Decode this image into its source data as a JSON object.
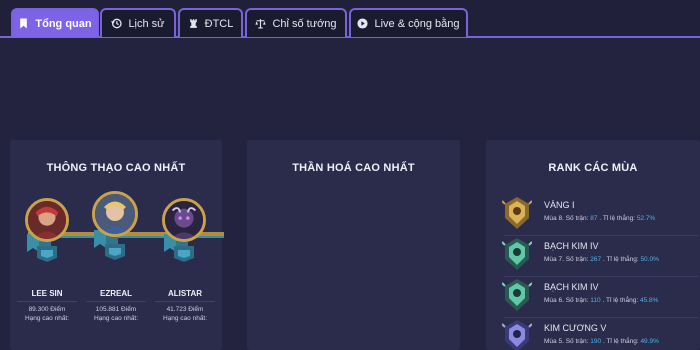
{
  "tabs": [
    {
      "label": "Tổng quan",
      "icon": "bookmark-icon",
      "active": true
    },
    {
      "label": "Lịch sử",
      "icon": "history-icon",
      "active": false
    },
    {
      "label": "ĐTCL",
      "icon": "chess-rook-icon",
      "active": false
    },
    {
      "label": "Chỉ số tướng",
      "icon": "balance-scale-icon",
      "active": false
    },
    {
      "label": "Live & cộng bằng",
      "icon": "play-circle-icon",
      "active": false
    }
  ],
  "mastery": {
    "title": "THÔNG THẠO CAO NHẤT",
    "champions": [
      {
        "name": "LEE SIN",
        "points": "89.300 Điểm",
        "rank": "Hạng cao nhất:"
      },
      {
        "name": "EZREAL",
        "points": "105.881 Điểm",
        "rank": "Hạng cao nhất:"
      },
      {
        "name": "ALISTAR",
        "points": "41.723 Điểm",
        "rank": "Hạng cao nhất:"
      }
    ]
  },
  "skins": {
    "title": "THẦN HOÁ CAO NHẤT"
  },
  "seasons": {
    "title": "RANK CÁC MÙA",
    "items": [
      {
        "rank": "VÀNG I",
        "season": "Mùa 8",
        "matches_label": "Số trận:",
        "matches": "87",
        "winrate_label": "Tỉ lệ thắng:",
        "winrate": "52.7%",
        "tier": "gold"
      },
      {
        "rank": "BẠCH KIM IV",
        "season": "Mùa 7",
        "matches_label": "Số trận:",
        "matches": "267",
        "winrate_label": "Tỉ lệ thắng:",
        "winrate": "50.0%",
        "tier": "platinum"
      },
      {
        "rank": "BẠCH KIM IV",
        "season": "Mùa 6",
        "matches_label": "Số trận:",
        "matches": "110",
        "winrate_label": "Tỉ lệ thắng:",
        "winrate": "45.8%",
        "tier": "platinum"
      },
      {
        "rank": "KIM CƯƠNG V",
        "season": "Mùa 5",
        "matches_label": "Số trận:",
        "matches": "190",
        "winrate_label": "Tỉ lệ thắng:",
        "winrate": "49.9%",
        "tier": "diamond"
      }
    ]
  },
  "colors": {
    "accent": "#7d63e6",
    "background": "#232340",
    "card": "#2b2b4c",
    "highlight": "#48b8e8",
    "gold_frame": "#c9a24a"
  }
}
